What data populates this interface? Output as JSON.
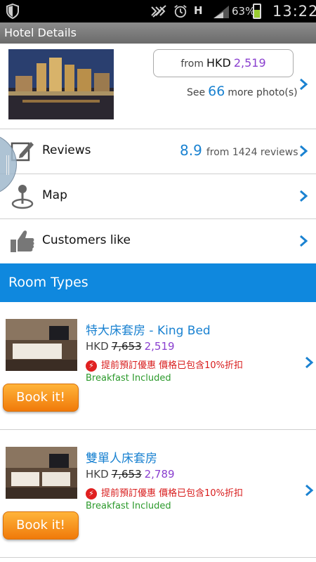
{
  "status_bar": {
    "battery_percent": "63%",
    "battery_level": 0.63,
    "network": "H",
    "clock": "13:22"
  },
  "title_bar": {
    "title": "Hotel Details"
  },
  "hero": {
    "price_from": "from",
    "price_currency": "HKD",
    "price_amount": "2,519",
    "photos_prefix": "See",
    "photos_count": "66",
    "photos_suffix": "more photo(s)"
  },
  "menu": {
    "reviews": {
      "label": "Reviews",
      "score": "8.9",
      "meta": "from 1424 reviews"
    },
    "map": {
      "label": "Map"
    },
    "customers_like": {
      "label": "Customers like"
    }
  },
  "section": {
    "room_types": "Room Types"
  },
  "rooms": [
    {
      "name": "特大床套房 - King Bed",
      "currency": "HKD",
      "old_price": "7,653",
      "new_price": "2,519",
      "promo": "提前預訂優惠 價格已包含10%折扣",
      "breakfast": "Breakfast Included",
      "book_label": "Book it!"
    },
    {
      "name": "雙單人床套房",
      "currency": "HKD",
      "old_price": "7,653",
      "new_price": "2,789",
      "promo": "提前預訂優惠 價格已包含10%折扣",
      "breakfast": "Breakfast Included",
      "book_label": "Book it!"
    }
  ],
  "colors": {
    "accent_blue": "#0f88de",
    "price_purple": "#8a3fcf",
    "promo_red": "#d81b1b",
    "breakfast_green": "#2c9a2c",
    "book_orange": "#f07a0a"
  }
}
